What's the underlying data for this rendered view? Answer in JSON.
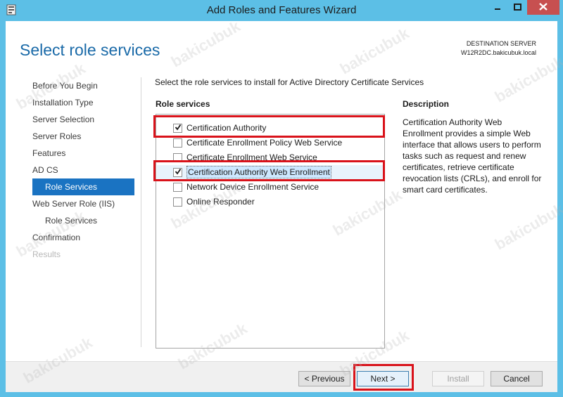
{
  "window": {
    "title": "Add Roles and Features Wizard",
    "icons": {
      "app": "server-manager-icon",
      "minimize": "minimize-icon",
      "maximize": "maximize-icon",
      "close": "close-icon"
    }
  },
  "header": {
    "page_title": "Select role services",
    "destination_label": "DESTINATION SERVER",
    "destination_server": "W12R2DC.bakicubuk.local"
  },
  "nav": {
    "items": [
      {
        "label": "Before You Begin",
        "state": "normal"
      },
      {
        "label": "Installation Type",
        "state": "normal"
      },
      {
        "label": "Server Selection",
        "state": "normal"
      },
      {
        "label": "Server Roles",
        "state": "normal"
      },
      {
        "label": "Features",
        "state": "normal"
      },
      {
        "label": "AD CS",
        "state": "normal"
      },
      {
        "label": "Role Services",
        "state": "active"
      },
      {
        "label": "Web Server Role (IIS)",
        "state": "normal"
      },
      {
        "label": "Role Services",
        "state": "sub"
      },
      {
        "label": "Confirmation",
        "state": "normal"
      },
      {
        "label": "Results",
        "state": "disabled"
      }
    ]
  },
  "main": {
    "instruction": "Select the role services to install for Active Directory Certificate Services",
    "role_services_header": "Role services",
    "role_services": [
      {
        "label": "Certification Authority",
        "checked": true
      },
      {
        "label": "Certificate Enrollment Policy Web Service",
        "checked": false
      },
      {
        "label": "Certificate Enrollment Web Service",
        "checked": false
      },
      {
        "label": "Certification Authority Web Enrollment",
        "checked": true,
        "selected": true
      },
      {
        "label": "Network Device Enrollment Service",
        "checked": false
      },
      {
        "label": "Online Responder",
        "checked": false
      }
    ],
    "description_header": "Description",
    "description_text": "Certification Authority Web Enrollment provides a simple Web interface that allows users to perform tasks such as request and renew certificates, retrieve certificate revocation lists (CRLs), and enroll for smart card certificates."
  },
  "footer": {
    "previous_label": "< Previous",
    "next_label": "Next >",
    "install_label": "Install",
    "cancel_label": "Cancel"
  },
  "colors": {
    "accent": "#1a73c2",
    "title_blue": "#1a6aa8",
    "highlight_red": "#d9121a",
    "frame": "#5cbfe6"
  },
  "watermark": "bakicubuk"
}
